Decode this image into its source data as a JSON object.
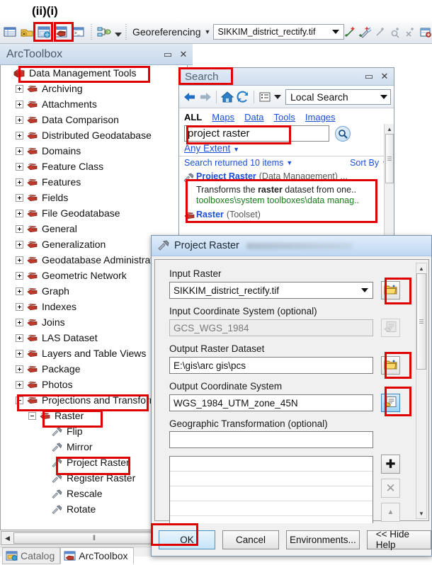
{
  "annotations": {
    "labels": "(ii)(i)"
  },
  "toolbar": {
    "icons": [
      "attribute-table-icon",
      "add-data-icon",
      "arccatalog-icon",
      "arctoolbox-icon",
      "command-line-icon",
      "model-builder-icon"
    ],
    "menu_label": "Georeferencing",
    "layer_combo_value": "SIKKIM_district_rectify.tif",
    "georef_icons": [
      "add-control-points-icon",
      "auto-register-icon",
      "view-link-table-icon",
      "zoom-link-icon",
      "delete-link-icon",
      "update-georeferencing-icon",
      "rectify-icon"
    ]
  },
  "arctoolbox": {
    "title": "ArcToolbox",
    "restore_glyph": "▭",
    "close_glyph": "✕",
    "tree": [
      {
        "label": "Data Management Tools",
        "depth": 0,
        "icon": "toolbox-icon",
        "expander": "none",
        "highlight": true
      },
      {
        "label": "Archiving",
        "depth": 1,
        "icon": "toolset-icon",
        "expander": "plus"
      },
      {
        "label": "Attachments",
        "depth": 1,
        "icon": "toolset-icon",
        "expander": "plus"
      },
      {
        "label": "Data Comparison",
        "depth": 1,
        "icon": "toolset-icon",
        "expander": "plus"
      },
      {
        "label": "Distributed Geodatabase",
        "depth": 1,
        "icon": "toolset-icon",
        "expander": "plus"
      },
      {
        "label": "Domains",
        "depth": 1,
        "icon": "toolset-icon",
        "expander": "plus"
      },
      {
        "label": "Feature Class",
        "depth": 1,
        "icon": "toolset-icon",
        "expander": "plus"
      },
      {
        "label": "Features",
        "depth": 1,
        "icon": "toolset-icon",
        "expander": "plus"
      },
      {
        "label": "Fields",
        "depth": 1,
        "icon": "toolset-icon",
        "expander": "plus"
      },
      {
        "label": "File Geodatabase",
        "depth": 1,
        "icon": "toolset-icon",
        "expander": "plus"
      },
      {
        "label": "General",
        "depth": 1,
        "icon": "toolset-icon",
        "expander": "plus"
      },
      {
        "label": "Generalization",
        "depth": 1,
        "icon": "toolset-icon",
        "expander": "plus"
      },
      {
        "label": "Geodatabase Administration",
        "depth": 1,
        "icon": "toolset-icon",
        "expander": "plus"
      },
      {
        "label": "Geometric Network",
        "depth": 1,
        "icon": "toolset-icon",
        "expander": "plus"
      },
      {
        "label": "Graph",
        "depth": 1,
        "icon": "toolset-icon",
        "expander": "plus"
      },
      {
        "label": "Indexes",
        "depth": 1,
        "icon": "toolset-icon",
        "expander": "plus"
      },
      {
        "label": "Joins",
        "depth": 1,
        "icon": "toolset-icon",
        "expander": "plus"
      },
      {
        "label": "LAS Dataset",
        "depth": 1,
        "icon": "toolset-icon",
        "expander": "plus"
      },
      {
        "label": "Layers and Table Views",
        "depth": 1,
        "icon": "toolset-icon",
        "expander": "plus"
      },
      {
        "label": "Package",
        "depth": 1,
        "icon": "toolset-icon",
        "expander": "plus"
      },
      {
        "label": "Photos",
        "depth": 1,
        "icon": "toolset-icon",
        "expander": "plus"
      },
      {
        "label": "Projections and Transformations",
        "depth": 1,
        "icon": "toolset-icon",
        "expander": "minus",
        "highlight": true
      },
      {
        "label": "Raster",
        "depth": 2,
        "icon": "toolset-icon",
        "expander": "minus",
        "highlight": true
      },
      {
        "label": "Flip",
        "depth": 3,
        "icon": "tool-icon",
        "expander": "none"
      },
      {
        "label": "Mirror",
        "depth": 3,
        "icon": "tool-icon",
        "expander": "none"
      },
      {
        "label": "Project Raster",
        "depth": 3,
        "icon": "tool-icon",
        "expander": "none",
        "highlight": true
      },
      {
        "label": "Register Raster",
        "depth": 3,
        "icon": "tool-icon",
        "expander": "none"
      },
      {
        "label": "Rescale",
        "depth": 3,
        "icon": "tool-icon",
        "expander": "none"
      },
      {
        "label": "Rotate",
        "depth": 3,
        "icon": "tool-icon",
        "expander": "none"
      }
    ],
    "hscroll": {
      "left_arrow": "◀",
      "thumb_grip": "‖"
    },
    "dock_tabs": [
      {
        "label": "Catalog",
        "icon": "catalog-icon",
        "active": false
      },
      {
        "label": "ArcToolbox",
        "icon": "arctoolbox-icon",
        "active": true
      }
    ]
  },
  "search": {
    "title": "Search",
    "restore_glyph": "▭",
    "close_glyph": "✕",
    "back_glyph": "➡",
    "forward_glyph": "➡",
    "home_icon": "home-icon",
    "refresh_icon": "refresh-icon",
    "view_icon": "list-view-icon",
    "scope_value": "Local Search",
    "tabs": [
      "ALL",
      "Maps",
      "Data",
      "Tools",
      "Images"
    ],
    "active_tab": "ALL",
    "query_value": "project raster",
    "search_button_icon": "magnifier-icon",
    "extent_link": "Any Extent",
    "results_count_label": "Search returned 10 items",
    "sort_by_label": "Sort By",
    "results": [
      {
        "icon": "tool-icon",
        "title": "Project Raster",
        "subtitle": "(Data Management) ...",
        "description_pre": "Transforms the ",
        "description_bold": "raster",
        "description_post": " dataset from one..",
        "path": "toolboxes\\system toolboxes\\data manag..",
        "highlight": true
      },
      {
        "icon": "toolset-icon",
        "title": "Raster",
        "subtitle": "(Toolset)",
        "highlight": false
      }
    ]
  },
  "dialog": {
    "title": "Project Raster",
    "title_icon": "tool-icon",
    "fields": [
      {
        "label": "Input Raster",
        "value": "SIKKIM_district_rectify.tif",
        "dropdown": true,
        "disabled": false,
        "button_icon": "open-folder-icon",
        "button_state": "normal",
        "button_highlight": true
      },
      {
        "label": "Input Coordinate System (optional)",
        "value": "GCS_WGS_1984",
        "dropdown": false,
        "disabled": true,
        "button_icon": "coordinate-system-icon",
        "button_state": "disabled",
        "button_highlight": false
      },
      {
        "label": "Output Raster Dataset",
        "value": "E:\\gis\\arc gis\\pcs",
        "dropdown": false,
        "disabled": false,
        "button_icon": "open-folder-icon",
        "button_state": "normal",
        "button_highlight": true
      },
      {
        "label": "Output Coordinate System",
        "value": "WGS_1984_UTM_zone_45N",
        "dropdown": false,
        "disabled": false,
        "button_icon": "coordinate-system-icon",
        "button_state": "selected",
        "button_highlight": true
      },
      {
        "label": "Geographic Transformation (optional)",
        "value": "",
        "dropdown": false,
        "disabled": false,
        "button_icon": "none",
        "button_state": "none",
        "button_highlight": false
      }
    ],
    "list_add_glyph": "✚",
    "list_remove_glyph": "✕",
    "list_up_glyph": "▲",
    "scroll_up_glyph": "▲",
    "scroll_down_glyph": "▼",
    "buttons": [
      {
        "label": "OK",
        "primary": true,
        "highlight": true
      },
      {
        "label": "Cancel",
        "primary": false,
        "highlight": false
      },
      {
        "label": "Environments...",
        "primary": false,
        "highlight": false
      },
      {
        "label": "<< Hide Help",
        "primary": false,
        "highlight": false
      }
    ]
  },
  "colors": {
    "highlight": "#e00000",
    "link": "#1a4fd6",
    "path": "#1d7a1d",
    "accent": "#c8def4"
  }
}
